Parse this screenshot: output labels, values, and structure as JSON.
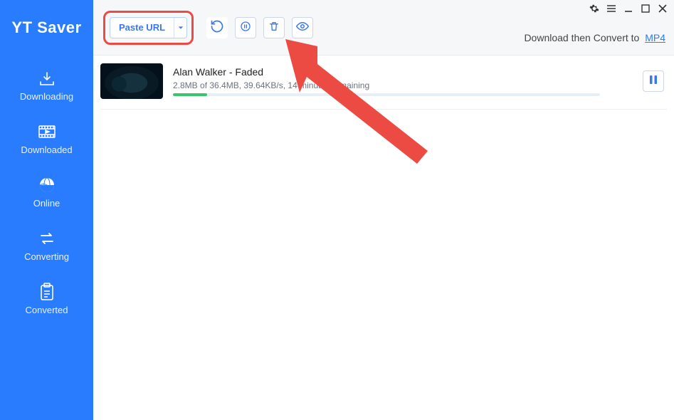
{
  "brand": "YT Saver",
  "sidebar": {
    "items": [
      {
        "label": "Downloading"
      },
      {
        "label": "Downloaded"
      },
      {
        "label": "Online"
      },
      {
        "label": "Converting"
      },
      {
        "label": "Converted"
      }
    ]
  },
  "toolbar": {
    "paste_label": "Paste URL",
    "download_convert_label": "Download then Convert to",
    "convert_format": "MP4"
  },
  "download": {
    "title": "Alan Walker - Faded",
    "downloaded_size": "2.8MB",
    "total_size": "36.4MB",
    "speed": "39.64KB/s",
    "remaining": "14 minutes remaining",
    "status_line": "2.8MB of 36.4MB, 39.64KB/s, 14 minutes remaining",
    "progress_percent": 8
  },
  "colors": {
    "brand_blue": "#2a7cff",
    "highlight_red": "#ec4b43",
    "progress_green": "#37c66a"
  }
}
